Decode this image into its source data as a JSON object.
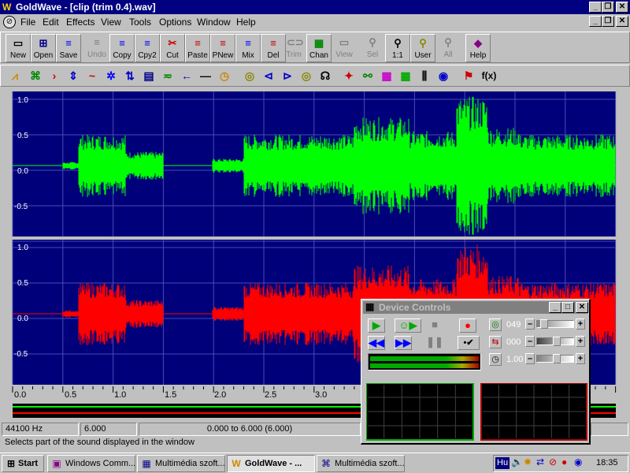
{
  "app": {
    "title": "GoldWave - [clip (trim 0.4).wav]"
  },
  "window_controls": {
    "minimize": "_",
    "restore": "❐",
    "close": "✕"
  },
  "menu": [
    "File",
    "Edit",
    "Effects",
    "View",
    "Tools",
    "Options",
    "Window",
    "Help"
  ],
  "toolbar1": [
    {
      "label": "New",
      "icon": "new-icon",
      "enabled": true
    },
    {
      "label": "Open",
      "icon": "open-icon",
      "enabled": true
    },
    {
      "label": "Save",
      "icon": "save-icon",
      "enabled": true
    },
    {
      "label": "Undo",
      "icon": "undo-icon",
      "enabled": false
    },
    {
      "label": "Copy",
      "icon": "copy-icon",
      "enabled": true
    },
    {
      "label": "Cpy2",
      "icon": "copy2-icon",
      "enabled": true
    },
    {
      "label": "Cut",
      "icon": "cut-icon",
      "enabled": true
    },
    {
      "label": "Paste",
      "icon": "paste-icon",
      "enabled": true
    },
    {
      "label": "PNew",
      "icon": "paste-new-icon",
      "enabled": true
    },
    {
      "label": "Mix",
      "icon": "mix-icon",
      "enabled": true
    },
    {
      "label": "Del",
      "icon": "delete-icon",
      "enabled": true
    },
    {
      "label": "Trim",
      "icon": "trim-icon",
      "enabled": false
    },
    {
      "label": "Chan",
      "icon": "channel-icon",
      "enabled": true
    },
    {
      "label": "View",
      "icon": "view-icon",
      "enabled": false
    },
    {
      "label": "Sel",
      "icon": "select-zoom-icon",
      "enabled": false
    },
    {
      "label": "1:1",
      "icon": "zoom-1to1-icon",
      "enabled": true
    },
    {
      "label": "User",
      "icon": "zoom-user-icon",
      "enabled": true
    },
    {
      "label": "All",
      "icon": "zoom-all-icon",
      "enabled": false
    },
    {
      "label": "Help",
      "icon": "help-book-icon",
      "enabled": true
    }
  ],
  "toolbar2_icons": [
    "auto-gain-icon",
    "dc-offset-icon",
    "echo-icon",
    "volume-icon",
    "reverse-icon",
    "doppler-icon",
    "invert-icon",
    "equalizer-icon",
    "filter-icon",
    "mechanize-icon",
    "offset-left-icon",
    "silence-icon",
    "time-warp-icon",
    "fade-in-icon",
    "fade-out-icon",
    "pan-icon",
    "play-rate-icon",
    "resample-icon",
    "transpose-icon",
    "stereo-icon",
    "spectrum-icon",
    "channel-mixer-icon",
    "bars-icon",
    "noise-icon",
    "marker-icon",
    "expression-icon"
  ],
  "waveform": {
    "top_labels": [
      "1.0",
      "0.5",
      "0.0",
      "-0.5"
    ],
    "bottom_labels": [
      "1.0",
      "0.5",
      "0.0",
      "-0.5"
    ],
    "time_labels": [
      "0.0",
      "0.5",
      "1.0",
      "1.5",
      "2.0",
      "2.5",
      "3.0"
    ],
    "left_color": "#00ff00",
    "right_color": "#ff0000",
    "bg_color": "#00007b",
    "grid_color": "#4a4ab5"
  },
  "device_controls": {
    "title": "Device Controls",
    "volume": "049",
    "balance": "000",
    "speed": "1.00"
  },
  "status": {
    "rate": "44100 Hz",
    "length": "6.000",
    "selection": "0.000 to 6.000  (6.000)",
    "message": "Selects part of the sound displayed in the window"
  },
  "taskbar": {
    "start": "Start",
    "tasks": [
      "Windows Comm...",
      "Multimédia szoft...",
      "GoldWave - ...",
      "Multimédia szoft..."
    ],
    "lang": "Hu",
    "clock": "18:35"
  }
}
